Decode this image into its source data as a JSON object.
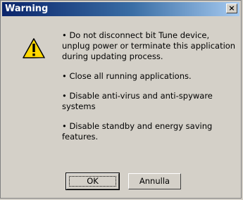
{
  "window": {
    "title": "Warning",
    "close_glyph": "×",
    "icon": "warning-triangle-icon"
  },
  "message": {
    "bullets": [
      "• Do not disconnect bit Tune device, unplug power or terminate this application during updating process.",
      "• Close all running applications.",
      "• Disable anti-virus and anti-spyware systems",
      "• Disable standby and energy saving features."
    ]
  },
  "buttons": {
    "ok_label": "OK",
    "cancel_label": "Annulla"
  },
  "colors": {
    "titlebar_start": "#0a246a",
    "titlebar_end": "#a6caf0",
    "face": "#d4d0c8",
    "icon_yellow": "#ffd800"
  }
}
